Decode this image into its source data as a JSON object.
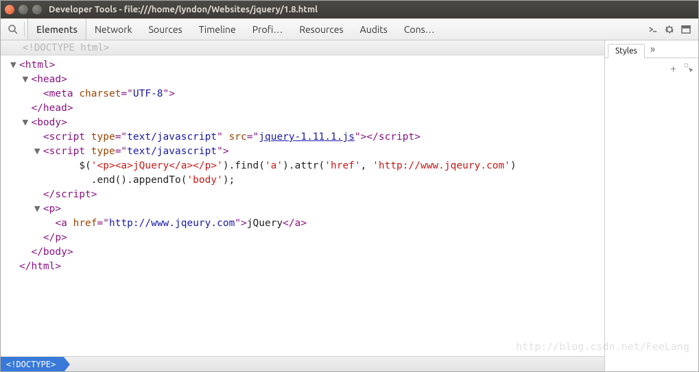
{
  "window": {
    "title": "Developer Tools - file:///home/lyndon/Websites/jquery/1.8.html"
  },
  "toolbar": {
    "tabs": [
      "Elements",
      "Network",
      "Sources",
      "Timeline",
      "Profi…",
      "Resources",
      "Audits",
      "Cons…"
    ],
    "active_index": 0
  },
  "doctype_gray": "<!DOCTYPE html>",
  "code_lines": [
    {
      "indent": 0,
      "toggle": "▼",
      "parts": [
        {
          "c": "t-tag",
          "t": "<html>"
        }
      ]
    },
    {
      "indent": 1,
      "toggle": "▼",
      "parts": [
        {
          "c": "t-tag",
          "t": "<head>"
        }
      ]
    },
    {
      "indent": 2,
      "toggle": "",
      "parts": [
        {
          "c": "t-tag",
          "t": "<meta "
        },
        {
          "c": "t-attr",
          "t": "charset"
        },
        {
          "c": "t-tag",
          "t": "=\""
        },
        {
          "c": "t-val",
          "t": "UTF-8"
        },
        {
          "c": "t-tag",
          "t": "\">"
        }
      ]
    },
    {
      "indent": 1,
      "toggle": "",
      "parts": [
        {
          "c": "t-tag",
          "t": "</head>"
        }
      ]
    },
    {
      "indent": 1,
      "toggle": "▼",
      "parts": [
        {
          "c": "t-tag",
          "t": "<body>"
        }
      ]
    },
    {
      "indent": 2,
      "toggle": "",
      "parts": [
        {
          "c": "t-tag",
          "t": "<script "
        },
        {
          "c": "t-attr",
          "t": "type"
        },
        {
          "c": "t-tag",
          "t": "=\""
        },
        {
          "c": "t-val",
          "t": "text/javascript"
        },
        {
          "c": "t-tag",
          "t": "\" "
        },
        {
          "c": "t-attr",
          "t": "src"
        },
        {
          "c": "t-tag",
          "t": "=\""
        },
        {
          "c": "t-link",
          "t": "jquery-1.11.1.js"
        },
        {
          "c": "t-tag",
          "t": "\"></scr"
        },
        {
          "c": "t-tag",
          "t": "ipt>"
        }
      ]
    },
    {
      "indent": 2,
      "toggle": "▼",
      "parts": [
        {
          "c": "t-tag",
          "t": "<script "
        },
        {
          "c": "t-attr",
          "t": "type"
        },
        {
          "c": "t-tag",
          "t": "=\""
        },
        {
          "c": "t-val",
          "t": "text/javascript"
        },
        {
          "c": "t-tag",
          "t": "\">"
        }
      ]
    },
    {
      "indent": 5,
      "toggle": "",
      "parts": [
        {
          "c": "t-txt",
          "t": "$("
        },
        {
          "c": "t-str",
          "t": "'<p><a>jQuery</a></p>'"
        },
        {
          "c": "t-txt",
          "t": ").find("
        },
        {
          "c": "t-str",
          "t": "'a'"
        },
        {
          "c": "t-txt",
          "t": ").attr("
        },
        {
          "c": "t-str",
          "t": "'href'"
        },
        {
          "c": "t-txt",
          "t": ", "
        },
        {
          "c": "t-str",
          "t": "'http://www.jqeury.com'"
        },
        {
          "c": "t-txt",
          "t": ")"
        }
      ]
    },
    {
      "indent": 6,
      "toggle": "",
      "parts": [
        {
          "c": "t-txt",
          "t": ".end().appendTo("
        },
        {
          "c": "t-str",
          "t": "'body'"
        },
        {
          "c": "t-txt",
          "t": ");"
        }
      ]
    },
    {
      "indent": 2,
      "toggle": "",
      "parts": [
        {
          "c": "t-tag",
          "t": "</scr"
        },
        {
          "c": "t-tag",
          "t": "ipt>"
        }
      ]
    },
    {
      "indent": 2,
      "toggle": "▼",
      "parts": [
        {
          "c": "t-tag",
          "t": "<p>"
        }
      ]
    },
    {
      "indent": 3,
      "toggle": "",
      "parts": [
        {
          "c": "t-tag",
          "t": "<a "
        },
        {
          "c": "t-attr",
          "t": "href"
        },
        {
          "c": "t-tag",
          "t": "=\""
        },
        {
          "c": "t-val",
          "t": "http://www.jqeury.com"
        },
        {
          "c": "t-tag",
          "t": "\">"
        },
        {
          "c": "t-txt",
          "t": "jQuery"
        },
        {
          "c": "t-tag",
          "t": "</a>"
        }
      ]
    },
    {
      "indent": 2,
      "toggle": "",
      "parts": [
        {
          "c": "t-tag",
          "t": "</p>"
        }
      ]
    },
    {
      "indent": 1,
      "toggle": "",
      "parts": [
        {
          "c": "t-tag",
          "t": "</body>"
        }
      ]
    },
    {
      "indent": 0,
      "toggle": "",
      "parts": [
        {
          "c": "t-tag",
          "t": "</html>"
        }
      ]
    }
  ],
  "breadcrumb": "<!DOCTYPE>",
  "right": {
    "tabs": [
      "Styles"
    ],
    "overflow": "»",
    "plus": "+"
  },
  "watermark": "http://blog.csdn.net/FeeLang"
}
